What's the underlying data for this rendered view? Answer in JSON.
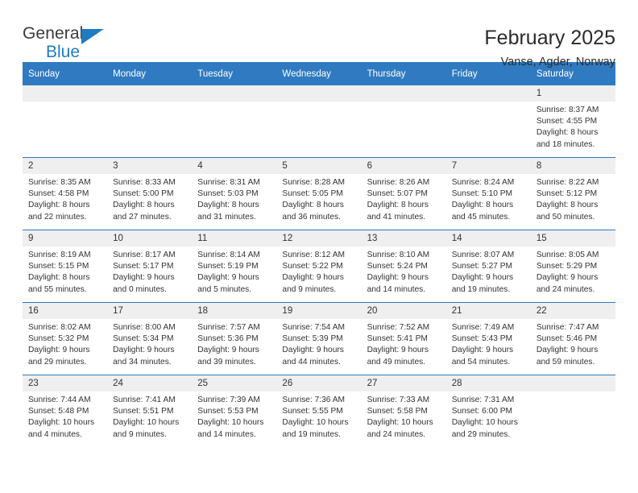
{
  "brand": {
    "name_top": "General",
    "name_bottom": "Blue",
    "accent_color": "#1f7ac0"
  },
  "header": {
    "title": "February 2025",
    "location": "Vanse, Agder, Norway"
  },
  "theme": {
    "header_blue": "#2f7ac0",
    "daynum_bg": "#efefef",
    "text": "#333333"
  },
  "weekdays": [
    "Sunday",
    "Monday",
    "Tuesday",
    "Wednesday",
    "Thursday",
    "Friday",
    "Saturday"
  ],
  "labels": {
    "sunrise": "Sunrise:",
    "sunset": "Sunset:",
    "daylight": "Daylight:"
  },
  "weeks": [
    [
      {
        "day": "",
        "lines": []
      },
      {
        "day": "",
        "lines": []
      },
      {
        "day": "",
        "lines": []
      },
      {
        "day": "",
        "lines": []
      },
      {
        "day": "",
        "lines": []
      },
      {
        "day": "",
        "lines": []
      },
      {
        "day": "1",
        "lines": [
          "Sunrise: 8:37 AM",
          "Sunset: 4:55 PM",
          "Daylight: 8 hours",
          "and 18 minutes."
        ]
      }
    ],
    [
      {
        "day": "2",
        "lines": [
          "Sunrise: 8:35 AM",
          "Sunset: 4:58 PM",
          "Daylight: 8 hours",
          "and 22 minutes."
        ]
      },
      {
        "day": "3",
        "lines": [
          "Sunrise: 8:33 AM",
          "Sunset: 5:00 PM",
          "Daylight: 8 hours",
          "and 27 minutes."
        ]
      },
      {
        "day": "4",
        "lines": [
          "Sunrise: 8:31 AM",
          "Sunset: 5:03 PM",
          "Daylight: 8 hours",
          "and 31 minutes."
        ]
      },
      {
        "day": "5",
        "lines": [
          "Sunrise: 8:28 AM",
          "Sunset: 5:05 PM",
          "Daylight: 8 hours",
          "and 36 minutes."
        ]
      },
      {
        "day": "6",
        "lines": [
          "Sunrise: 8:26 AM",
          "Sunset: 5:07 PM",
          "Daylight: 8 hours",
          "and 41 minutes."
        ]
      },
      {
        "day": "7",
        "lines": [
          "Sunrise: 8:24 AM",
          "Sunset: 5:10 PM",
          "Daylight: 8 hours",
          "and 45 minutes."
        ]
      },
      {
        "day": "8",
        "lines": [
          "Sunrise: 8:22 AM",
          "Sunset: 5:12 PM",
          "Daylight: 8 hours",
          "and 50 minutes."
        ]
      }
    ],
    [
      {
        "day": "9",
        "lines": [
          "Sunrise: 8:19 AM",
          "Sunset: 5:15 PM",
          "Daylight: 8 hours",
          "and 55 minutes."
        ]
      },
      {
        "day": "10",
        "lines": [
          "Sunrise: 8:17 AM",
          "Sunset: 5:17 PM",
          "Daylight: 9 hours",
          "and 0 minutes."
        ]
      },
      {
        "day": "11",
        "lines": [
          "Sunrise: 8:14 AM",
          "Sunset: 5:19 PM",
          "Daylight: 9 hours",
          "and 5 minutes."
        ]
      },
      {
        "day": "12",
        "lines": [
          "Sunrise: 8:12 AM",
          "Sunset: 5:22 PM",
          "Daylight: 9 hours",
          "and 9 minutes."
        ]
      },
      {
        "day": "13",
        "lines": [
          "Sunrise: 8:10 AM",
          "Sunset: 5:24 PM",
          "Daylight: 9 hours",
          "and 14 minutes."
        ]
      },
      {
        "day": "14",
        "lines": [
          "Sunrise: 8:07 AM",
          "Sunset: 5:27 PM",
          "Daylight: 9 hours",
          "and 19 minutes."
        ]
      },
      {
        "day": "15",
        "lines": [
          "Sunrise: 8:05 AM",
          "Sunset: 5:29 PM",
          "Daylight: 9 hours",
          "and 24 minutes."
        ]
      }
    ],
    [
      {
        "day": "16",
        "lines": [
          "Sunrise: 8:02 AM",
          "Sunset: 5:32 PM",
          "Daylight: 9 hours",
          "and 29 minutes."
        ]
      },
      {
        "day": "17",
        "lines": [
          "Sunrise: 8:00 AM",
          "Sunset: 5:34 PM",
          "Daylight: 9 hours",
          "and 34 minutes."
        ]
      },
      {
        "day": "18",
        "lines": [
          "Sunrise: 7:57 AM",
          "Sunset: 5:36 PM",
          "Daylight: 9 hours",
          "and 39 minutes."
        ]
      },
      {
        "day": "19",
        "lines": [
          "Sunrise: 7:54 AM",
          "Sunset: 5:39 PM",
          "Daylight: 9 hours",
          "and 44 minutes."
        ]
      },
      {
        "day": "20",
        "lines": [
          "Sunrise: 7:52 AM",
          "Sunset: 5:41 PM",
          "Daylight: 9 hours",
          "and 49 minutes."
        ]
      },
      {
        "day": "21",
        "lines": [
          "Sunrise: 7:49 AM",
          "Sunset: 5:43 PM",
          "Daylight: 9 hours",
          "and 54 minutes."
        ]
      },
      {
        "day": "22",
        "lines": [
          "Sunrise: 7:47 AM",
          "Sunset: 5:46 PM",
          "Daylight: 9 hours",
          "and 59 minutes."
        ]
      }
    ],
    [
      {
        "day": "23",
        "lines": [
          "Sunrise: 7:44 AM",
          "Sunset: 5:48 PM",
          "Daylight: 10 hours",
          "and 4 minutes."
        ]
      },
      {
        "day": "24",
        "lines": [
          "Sunrise: 7:41 AM",
          "Sunset: 5:51 PM",
          "Daylight: 10 hours",
          "and 9 minutes."
        ]
      },
      {
        "day": "25",
        "lines": [
          "Sunrise: 7:39 AM",
          "Sunset: 5:53 PM",
          "Daylight: 10 hours",
          "and 14 minutes."
        ]
      },
      {
        "day": "26",
        "lines": [
          "Sunrise: 7:36 AM",
          "Sunset: 5:55 PM",
          "Daylight: 10 hours",
          "and 19 minutes."
        ]
      },
      {
        "day": "27",
        "lines": [
          "Sunrise: 7:33 AM",
          "Sunset: 5:58 PM",
          "Daylight: 10 hours",
          "and 24 minutes."
        ]
      },
      {
        "day": "28",
        "lines": [
          "Sunrise: 7:31 AM",
          "Sunset: 6:00 PM",
          "Daylight: 10 hours",
          "and 29 minutes."
        ]
      },
      {
        "day": "",
        "lines": []
      }
    ]
  ]
}
